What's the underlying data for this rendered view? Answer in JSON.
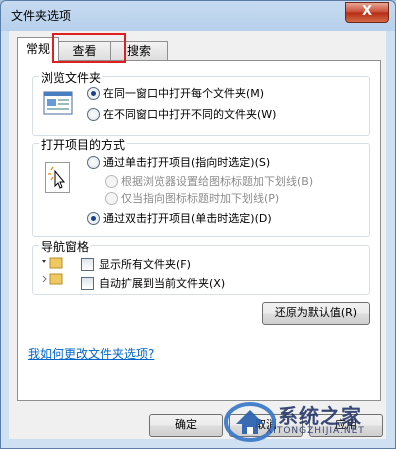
{
  "window": {
    "title": "文件夹选项",
    "close_glyph": "X"
  },
  "tabs": [
    {
      "label": "常规",
      "active": true
    },
    {
      "label": "查看",
      "active": false,
      "highlighted": true
    },
    {
      "label": "搜索",
      "active": false
    }
  ],
  "browse_group": {
    "title": "浏览文件夹",
    "options": [
      {
        "label": "在同一窗口中打开每个文件夹(M)",
        "checked": true
      },
      {
        "label": "在不同窗口中打开不同的文件夹(W)",
        "checked": false
      }
    ]
  },
  "click_group": {
    "title": "打开项目的方式",
    "options": [
      {
        "label": "通过单击打开项目(指向时选定)(S)",
        "checked": false,
        "disabled": false
      },
      {
        "label": "根据浏览器设置给图标标题加下划线(B)",
        "checked": false,
        "disabled": true
      },
      {
        "label": "仅当指向图标标题时加下划线(P)",
        "checked": true,
        "disabled": true
      },
      {
        "label": "通过双击打开项目(单击时选定)(D)",
        "checked": true,
        "disabled": false
      }
    ]
  },
  "nav_group": {
    "title": "导航窗格",
    "options": [
      {
        "label": "显示所有文件夹(F)",
        "checked": false
      },
      {
        "label": "自动扩展到当前文件夹(X)",
        "checked": false
      }
    ]
  },
  "restore_button": "还原为默认值(R)",
  "help_link": "我如何更改文件夹选项?",
  "footer": {
    "ok": "确定",
    "cancel": "取消",
    "apply": "应用"
  },
  "watermark": {
    "text": "系统之家",
    "sub": "XITONGZHIJIA.NET"
  },
  "colors": {
    "highlight": "#e02020",
    "link": "#0066cc",
    "accent": "#1c3f86"
  }
}
